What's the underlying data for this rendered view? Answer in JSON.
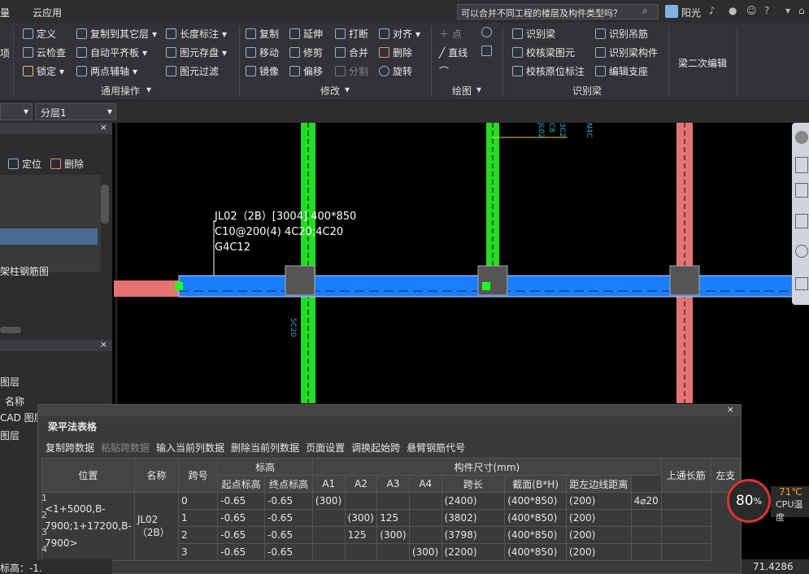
{
  "menubar": {
    "items": [
      "量",
      "云应用"
    ],
    "search_placeholder": "可以合并不同工程的楼层及构件类型吗？",
    "user": "阳光"
  },
  "ribbon": {
    "general": {
      "label": "通用操作",
      "items": [
        "定义",
        "云检查",
        "锁定",
        "复制到其它层",
        "自动平齐板",
        "两点辅轴",
        "长度标注",
        "图元存盘",
        "图元过滤"
      ]
    },
    "modify": {
      "label": "修改",
      "items": [
        "复制",
        "延伸",
        "打断",
        "对齐",
        "移动",
        "修剪",
        "合并",
        "删除",
        "镜像",
        "偏移",
        "分割",
        "旋转"
      ]
    },
    "draw": {
      "label": "绘图",
      "items": [
        "点",
        "直线"
      ]
    },
    "recognize": {
      "label": "识别梁",
      "items": [
        "识别梁",
        "识别吊筋",
        "校核梁图元",
        "识别梁构件",
        "校核原位标注",
        "编辑支座"
      ]
    },
    "secondary_edit": "梁二次编辑",
    "left_cut": "项"
  },
  "layerbar": {
    "layer": "分层1"
  },
  "leftpanel": {
    "top_actions": [
      "定位",
      "删除"
    ],
    "item_rebar": "架柱钢筋图",
    "section2_title": "图层",
    "col_name": "名称",
    "layers": [
      "CAD 图层",
      "图层"
    ]
  },
  "canvas": {
    "beam_label_lines": [
      "JL02（2B）[3004] 400*850",
      "C10@200(4) 4C20;4C20",
      "G4C12"
    ]
  },
  "dialog": {
    "title": "梁平法表格",
    "toolbar": [
      "复制跨数据",
      "粘贴跨数据",
      "输入当前列数据",
      "删除当前列数据",
      "页面设置",
      "调换起始跨",
      "悬臂钢筋代号"
    ],
    "headers_top": {
      "elev": "标高",
      "dims": "构件尺寸(mm)"
    },
    "headers": [
      "位置",
      "名称",
      "跨号",
      "起点标高",
      "终点标高",
      "A1",
      "A2",
      "A3",
      "A4",
      "跨长",
      "截面(B*H)",
      "距左边线距离",
      "上通长筋",
      "左支"
    ],
    "position_text": "<1+5000,B-7900;1+17200,B-7900>",
    "name_text": "JL02（2B）",
    "rows": [
      {
        "n": "1",
        "span": "0",
        "start": "-0.65",
        "end": "-0.65",
        "a1": "(300)",
        "a2": "",
        "a3": "",
        "a4": "",
        "len": "(2400)",
        "sec": "(400*850)",
        "dist": "(200)",
        "top": "4⌀20"
      },
      {
        "n": "2",
        "span": "1",
        "start": "-0.65",
        "end": "-0.65",
        "a1": "",
        "a2": "(300)",
        "a3": "125",
        "a4": "",
        "len": "(3802)",
        "sec": "(400*850)",
        "dist": "(200)",
        "top": ""
      },
      {
        "n": "3",
        "span": "2",
        "start": "-0.65",
        "end": "-0.65",
        "a1": "",
        "a2": "125",
        "a3": "(300)",
        "a4": "",
        "len": "(3798)",
        "sec": "(400*850)",
        "dist": "(200)",
        "top": ""
      },
      {
        "n": "4",
        "span": "3",
        "start": "-0.65",
        "end": "-0.65",
        "a1": "",
        "a2": "",
        "a3": "",
        "a4": "(300)",
        "len": "(2200)",
        "sec": "(400*850)",
        "dist": "(200)",
        "top": ""
      }
    ]
  },
  "cpu": {
    "percent": "80",
    "temp": "71℃",
    "label": "CPU温度"
  },
  "status": {
    "elev": "标高：-1.",
    "fps": "71.4286 FPS"
  },
  "colors": {
    "beam": "#1a7fff",
    "column_green": "#22dd22",
    "column_red": "#e57373",
    "dialog_bg": "#3a3a3a"
  }
}
